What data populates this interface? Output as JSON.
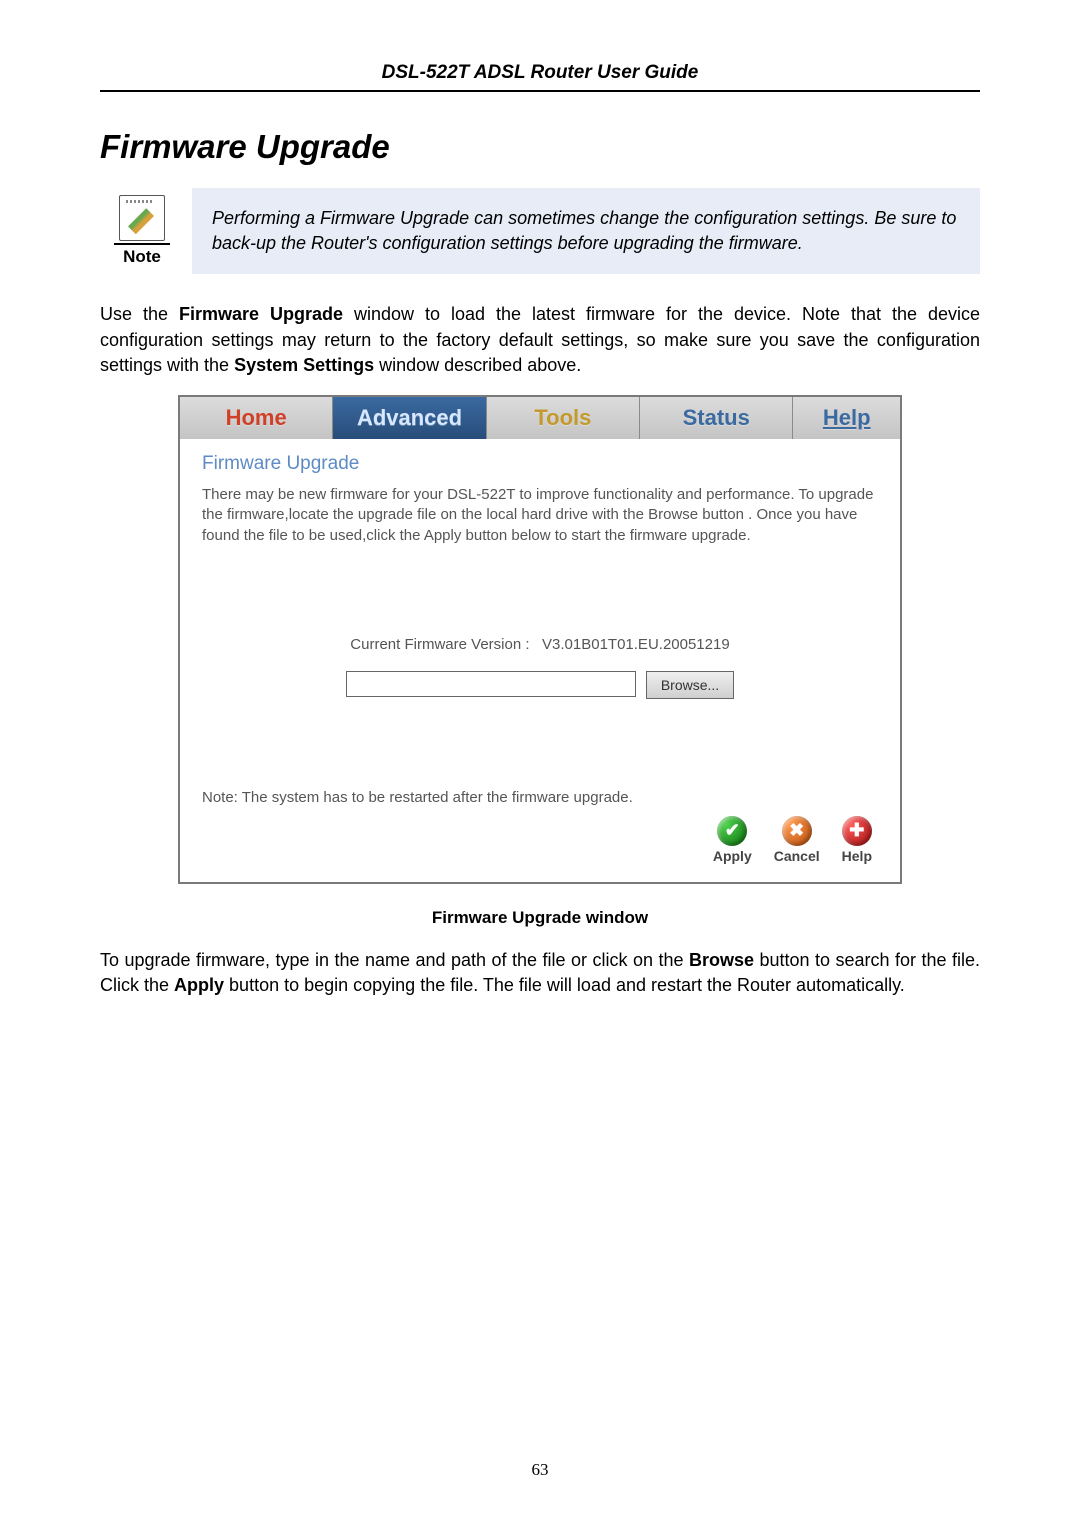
{
  "header": {
    "title": "DSL-522T ADSL Router User Guide"
  },
  "section_title": "Firmware Upgrade",
  "note_box": {
    "label": "Note",
    "text": "Performing a Firmware Upgrade can sometimes change the configuration settings. Be sure to back-up the Router's configuration settings before upgrading the firmware."
  },
  "para1": {
    "pre": "Use the ",
    "b1": "Firmware Upgrade",
    "mid": " window to load the latest firmware for the device. Note that the device configuration settings may return to the factory default settings, so make sure you save the configuration settings with the ",
    "b2": "System Settings",
    "post": " window described above."
  },
  "ui": {
    "tabs": {
      "home": "Home",
      "advanced": "Advanced",
      "tools": "Tools",
      "status": "Status",
      "help": "Help"
    },
    "section_title": "Firmware Upgrade",
    "description": "There may be new firmware for your DSL-522T to improve functionality and performance. To upgrade the firmware,locate the upgrade file on the local hard drive with the Browse button . Once you have found the file to be used,click the Apply button below to start the firmware upgrade.",
    "version_label": "Current Firmware Version :",
    "version_value": "V3.01B01T01.EU.20051219",
    "file_value": "",
    "browse_label": "Browse...",
    "restart_note": "Note: The system has to be restarted after the firmware upgrade.",
    "actions": {
      "apply": "Apply",
      "cancel": "Cancel",
      "help": "Help"
    }
  },
  "figure_caption": "Firmware Upgrade window",
  "para2": {
    "pre": "To upgrade firmware, type in the name and path of the file or click on the ",
    "b1": "Browse",
    "mid": " button to search for the file. Click the ",
    "b2": "Apply",
    "post": " button to begin copying the file. The file will load and restart the Router automatically."
  },
  "page_number": "63"
}
